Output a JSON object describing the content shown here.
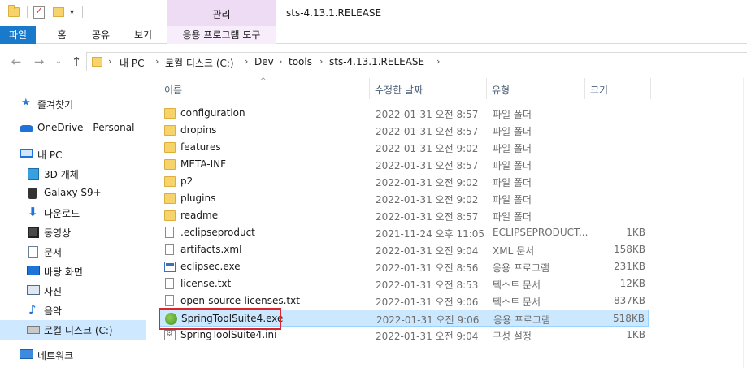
{
  "titlebar": {
    "manage_tab": "관리",
    "window_title": "sts-4.13.1.RELEASE"
  },
  "ribbon": {
    "tabs": [
      "파일",
      "홈",
      "공유",
      "보기",
      "응용 프로그램 도구"
    ]
  },
  "address": {
    "crumbs": [
      "내 PC",
      "로컬 디스크 (C:)",
      "Dev",
      "tools",
      "sts-4.13.1.RELEASE"
    ]
  },
  "sidebar": {
    "items": [
      {
        "label": "즐겨찾기",
        "icon": "star-icon"
      },
      {
        "label": "OneDrive - Personal",
        "icon": "cloud-icon"
      },
      {
        "label": "내 PC",
        "icon": "computer-icon"
      },
      {
        "label": "3D 개체",
        "icon": "cube-icon"
      },
      {
        "label": "Galaxy S9+",
        "icon": "phone-icon"
      },
      {
        "label": "다운로드",
        "icon": "download-icon"
      },
      {
        "label": "동영상",
        "icon": "video-icon"
      },
      {
        "label": "문서",
        "icon": "document-icon"
      },
      {
        "label": "바탕 화면",
        "icon": "desktop-icon"
      },
      {
        "label": "사진",
        "icon": "picture-icon"
      },
      {
        "label": "음악",
        "icon": "music-icon"
      },
      {
        "label": "로컬 디스크 (C:)",
        "icon": "drive-icon"
      },
      {
        "label": "네트워크",
        "icon": "network-icon"
      }
    ]
  },
  "columns": {
    "name": "이름",
    "date": "수정한 날짜",
    "type": "유형",
    "size": "크기"
  },
  "files": [
    {
      "name": "configuration",
      "date": "2022-01-31 오전 8:57",
      "type": "파일 폴더",
      "size": "",
      "icon": "folder-icon"
    },
    {
      "name": "dropins",
      "date": "2022-01-31 오전 8:57",
      "type": "파일 폴더",
      "size": "",
      "icon": "folder-icon"
    },
    {
      "name": "features",
      "date": "2022-01-31 오전 9:02",
      "type": "파일 폴더",
      "size": "",
      "icon": "folder-icon"
    },
    {
      "name": "META-INF",
      "date": "2022-01-31 오전 8:57",
      "type": "파일 폴더",
      "size": "",
      "icon": "folder-icon"
    },
    {
      "name": "p2",
      "date": "2022-01-31 오전 9:02",
      "type": "파일 폴더",
      "size": "",
      "icon": "folder-icon"
    },
    {
      "name": "plugins",
      "date": "2022-01-31 오전 9:02",
      "type": "파일 폴더",
      "size": "",
      "icon": "folder-icon"
    },
    {
      "name": "readme",
      "date": "2022-01-31 오전 8:57",
      "type": "파일 폴더",
      "size": "",
      "icon": "folder-icon"
    },
    {
      "name": ".eclipseproduct",
      "date": "2021-11-24 오후 11:05",
      "type": "ECLIPSEPRODUCT...",
      "size": "1KB",
      "icon": "file-icon"
    },
    {
      "name": "artifacts.xml",
      "date": "2022-01-31 오전 9:04",
      "type": "XML 문서",
      "size": "158KB",
      "icon": "file-icon"
    },
    {
      "name": "eclipsec.exe",
      "date": "2022-01-31 오전 8:56",
      "type": "응용 프로그램",
      "size": "231KB",
      "icon": "exe-icon"
    },
    {
      "name": "license.txt",
      "date": "2022-01-31 오전 8:53",
      "type": "텍스트 문서",
      "size": "12KB",
      "icon": "text-file-icon"
    },
    {
      "name": "open-source-licenses.txt",
      "date": "2022-01-31 오전 9:06",
      "type": "텍스트 문서",
      "size": "837KB",
      "icon": "text-file-icon"
    },
    {
      "name": "SpringToolSuite4.exe",
      "date": "2022-01-31 오전 9:06",
      "type": "응용 프로그램",
      "size": "518KB",
      "icon": "spring-icon",
      "selected": true
    },
    {
      "name": "SpringToolSuite4.ini",
      "date": "2022-01-31 오전 9:04",
      "type": "구성 설정",
      "size": "1KB",
      "icon": "settings-file-icon"
    }
  ]
}
